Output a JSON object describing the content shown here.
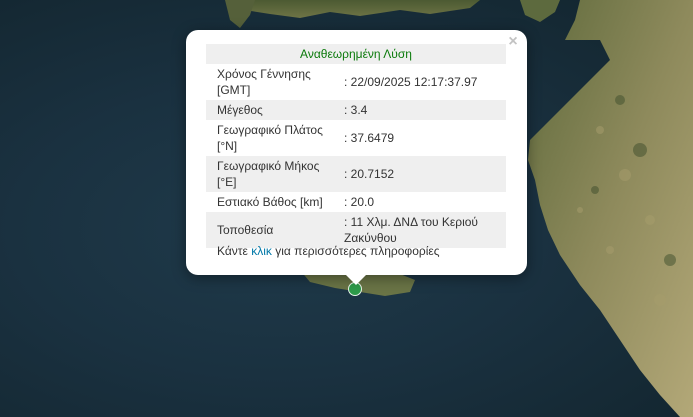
{
  "popup": {
    "title": "Αναθεωρημένη Λύση",
    "close_symbol": "×",
    "rows": [
      {
        "label": "Χρόνος Γέννησης [GMT]",
        "value": ": 22/09/2025 12:17:37.97"
      },
      {
        "label": "Μέγεθος",
        "value": ": 3.4"
      },
      {
        "label": "Γεωγραφικό Πλάτος [°N]",
        "value": ": 37.6479"
      },
      {
        "label": "Γεωγραφικό Μήκος [°E]",
        "value": ": 20.7152"
      },
      {
        "label": "Εστιακό Βάθος [km]",
        "value": ": 20.0"
      },
      {
        "label": "Τοποθεσία",
        "value": ": 11 Χλμ. ΔΝΔ του Κεριού Ζακύνθου"
      }
    ],
    "footer_prefix": "Κάντε ",
    "footer_link": "κλικ",
    "footer_suffix": " για περισσότερες πληροφορίες"
  },
  "map": {
    "marker_icon": "earthquake-marker-icon",
    "marker_color": "#2e9b4a",
    "water_color": "#1a3140",
    "land_color": "#8a8f5a"
  }
}
